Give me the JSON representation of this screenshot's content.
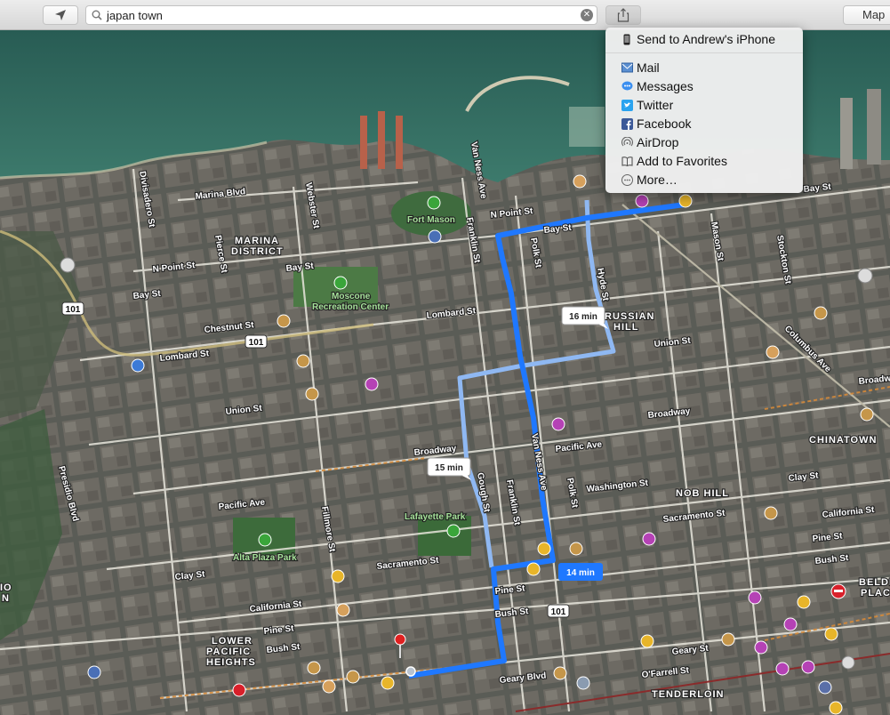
{
  "toolbar": {
    "search_value": "japan town",
    "map_button_label": "Map"
  },
  "share_menu": {
    "send_to_device": "Send to Andrew's iPhone",
    "items": [
      "Mail",
      "Messages",
      "Twitter",
      "Facebook",
      "AirDrop",
      "Add to Favorites",
      "More…"
    ]
  },
  "map": {
    "districts": [
      "MARINA",
      "DISTRICT",
      "RUSSIAN",
      "HILL",
      "CHINATOWN",
      "NOB HILL",
      "TENDERLOIN",
      "LOWER",
      "PACIFIC",
      "HEIGHTS",
      "BELDE",
      "PLAC",
      "IO",
      "N"
    ],
    "parks": [
      "Fort Mason",
      "Moscone",
      "Recreation Center",
      "Lafayette Park",
      "Alta Plaza Park"
    ],
    "streets": [
      "Marina Blvd",
      "N Point St",
      "Bay St",
      "Chestnut St",
      "Lombard St",
      "Union St",
      "Broadway",
      "Pacific Ave",
      "Washington St",
      "Clay St",
      "Sacramento St",
      "California St",
      "Pine St",
      "Bush St",
      "Geary Blvd",
      "O'Farrell St",
      "Geary St",
      "Van Ness Ave",
      "Franklin St",
      "Polk St",
      "Hyde St",
      "Gough St",
      "Fillmore St",
      "Webster St",
      "Pierce St",
      "Divisadero St",
      "Presidio Blvd",
      "Mason St",
      "Stockton St",
      "Columbus Ave",
      "Broadway",
      "Bay St"
    ],
    "shields": [
      "101",
      "101",
      "101"
    ],
    "route_times": [
      "16 min",
      "15 min",
      "14 min"
    ]
  },
  "colors": {
    "route_primary": "#1f78ff",
    "route_alt": "#8fb8f2",
    "water": "#2f6a5f",
    "pin": "#e02020"
  }
}
